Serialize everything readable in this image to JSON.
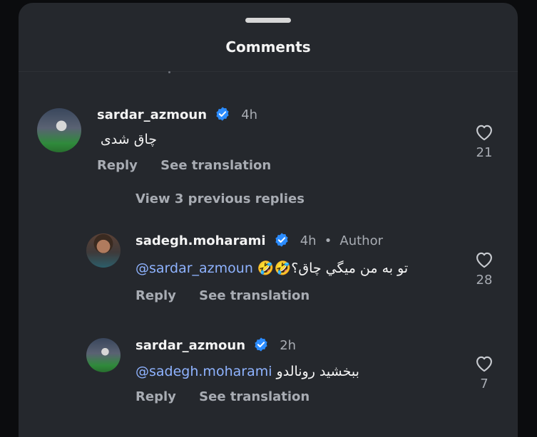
{
  "sheet": {
    "title": "Comments"
  },
  "comments": [
    {
      "username": "sardar_azmoun",
      "time": "4h",
      "text": "چاق شدی",
      "reply_label": "Reply",
      "translate_label": "See translation",
      "likes": "21"
    }
  ],
  "view_previous": "View 3 previous replies",
  "replies": [
    {
      "username": "sadegh.moharami",
      "time": "4h",
      "separator": "•",
      "badge": "Author",
      "mention": "@sardar_azmoun",
      "text": "تو به من میگي چاق؟🤣🤣",
      "reply_label": "Reply",
      "translate_label": "See translation",
      "likes": "28"
    },
    {
      "username": "sardar_azmoun",
      "time": "2h",
      "mention": "@sadegh.moharami",
      "text": "ببخشید رونالدو",
      "reply_label": "Reply",
      "translate_label": "See translation",
      "likes": "7"
    }
  ],
  "colors": {
    "verified": "#2b8cff",
    "mention": "#8fb3ff",
    "background": "#25282d"
  }
}
